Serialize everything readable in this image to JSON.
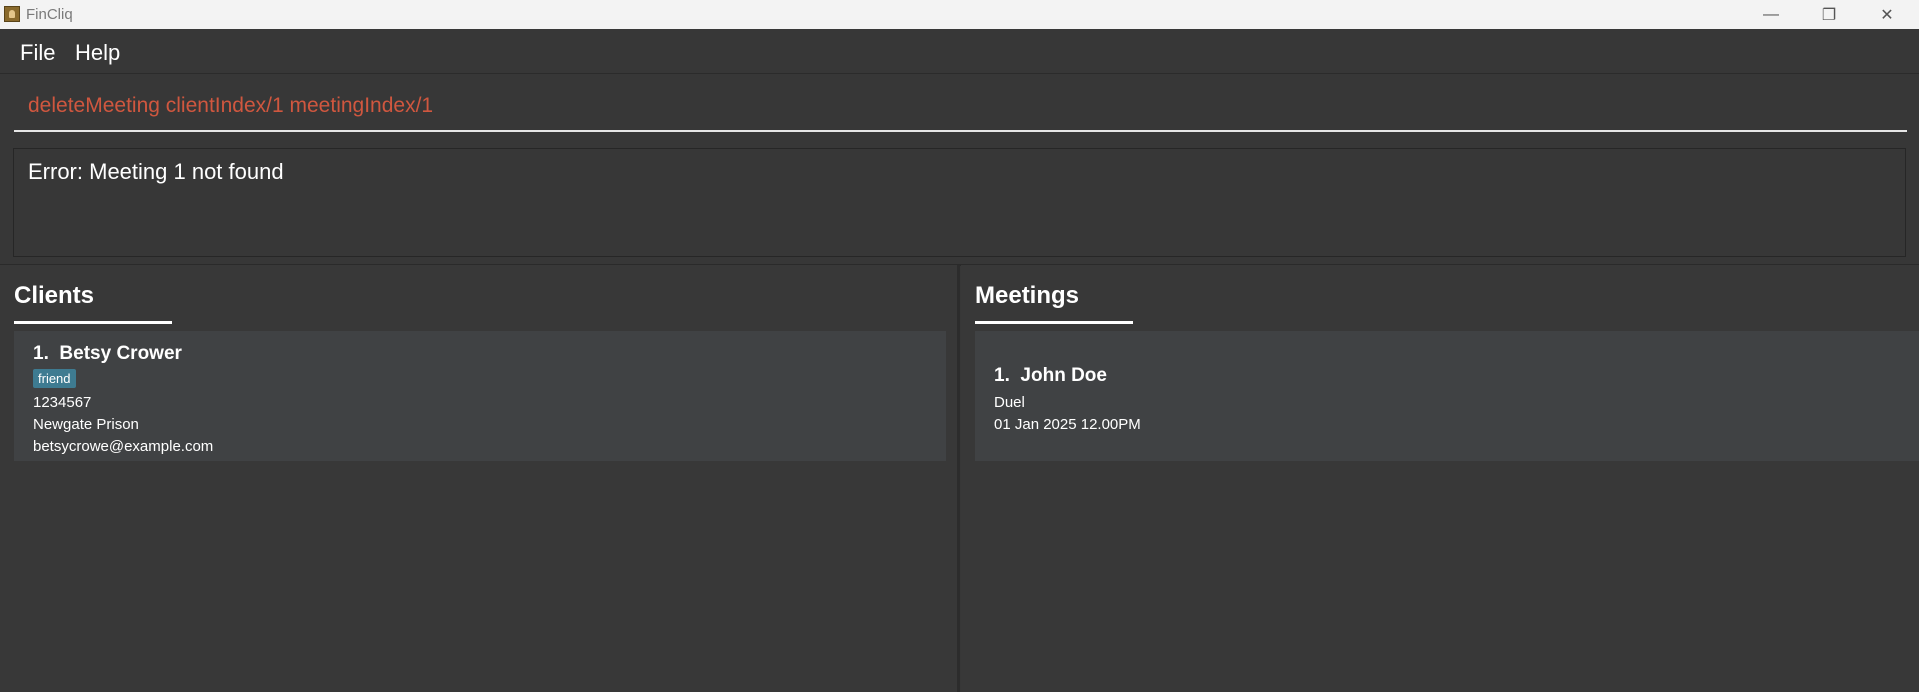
{
  "window": {
    "title": "FinCliq",
    "icon": "app-icon",
    "controls": [
      "minimize-icon",
      "restore-icon",
      "close-icon"
    ]
  },
  "menu": {
    "file": "File",
    "help": "Help"
  },
  "command": {
    "value": "deleteMeeting clientIndex/1 meetingIndex/1",
    "color": "#d0573f"
  },
  "result": {
    "text": "Error: Meeting 1 not found"
  },
  "clients": {
    "title": "Clients",
    "items": [
      {
        "index": "1.",
        "name": "Betsy Crower",
        "tags": [
          "friend"
        ],
        "phone": "1234567",
        "address": "Newgate Prison",
        "email": "betsycrowe@example.com"
      }
    ]
  },
  "meetings": {
    "title": "Meetings",
    "items": [
      {
        "index": "1.",
        "name": "John Doe",
        "title": "Duel",
        "datetime": "01 Jan 2025 12.00PM"
      }
    ]
  },
  "colors": {
    "background": "#373737",
    "card": "#404244",
    "tag": "#3e7b91",
    "error_text": "#d0573f"
  }
}
